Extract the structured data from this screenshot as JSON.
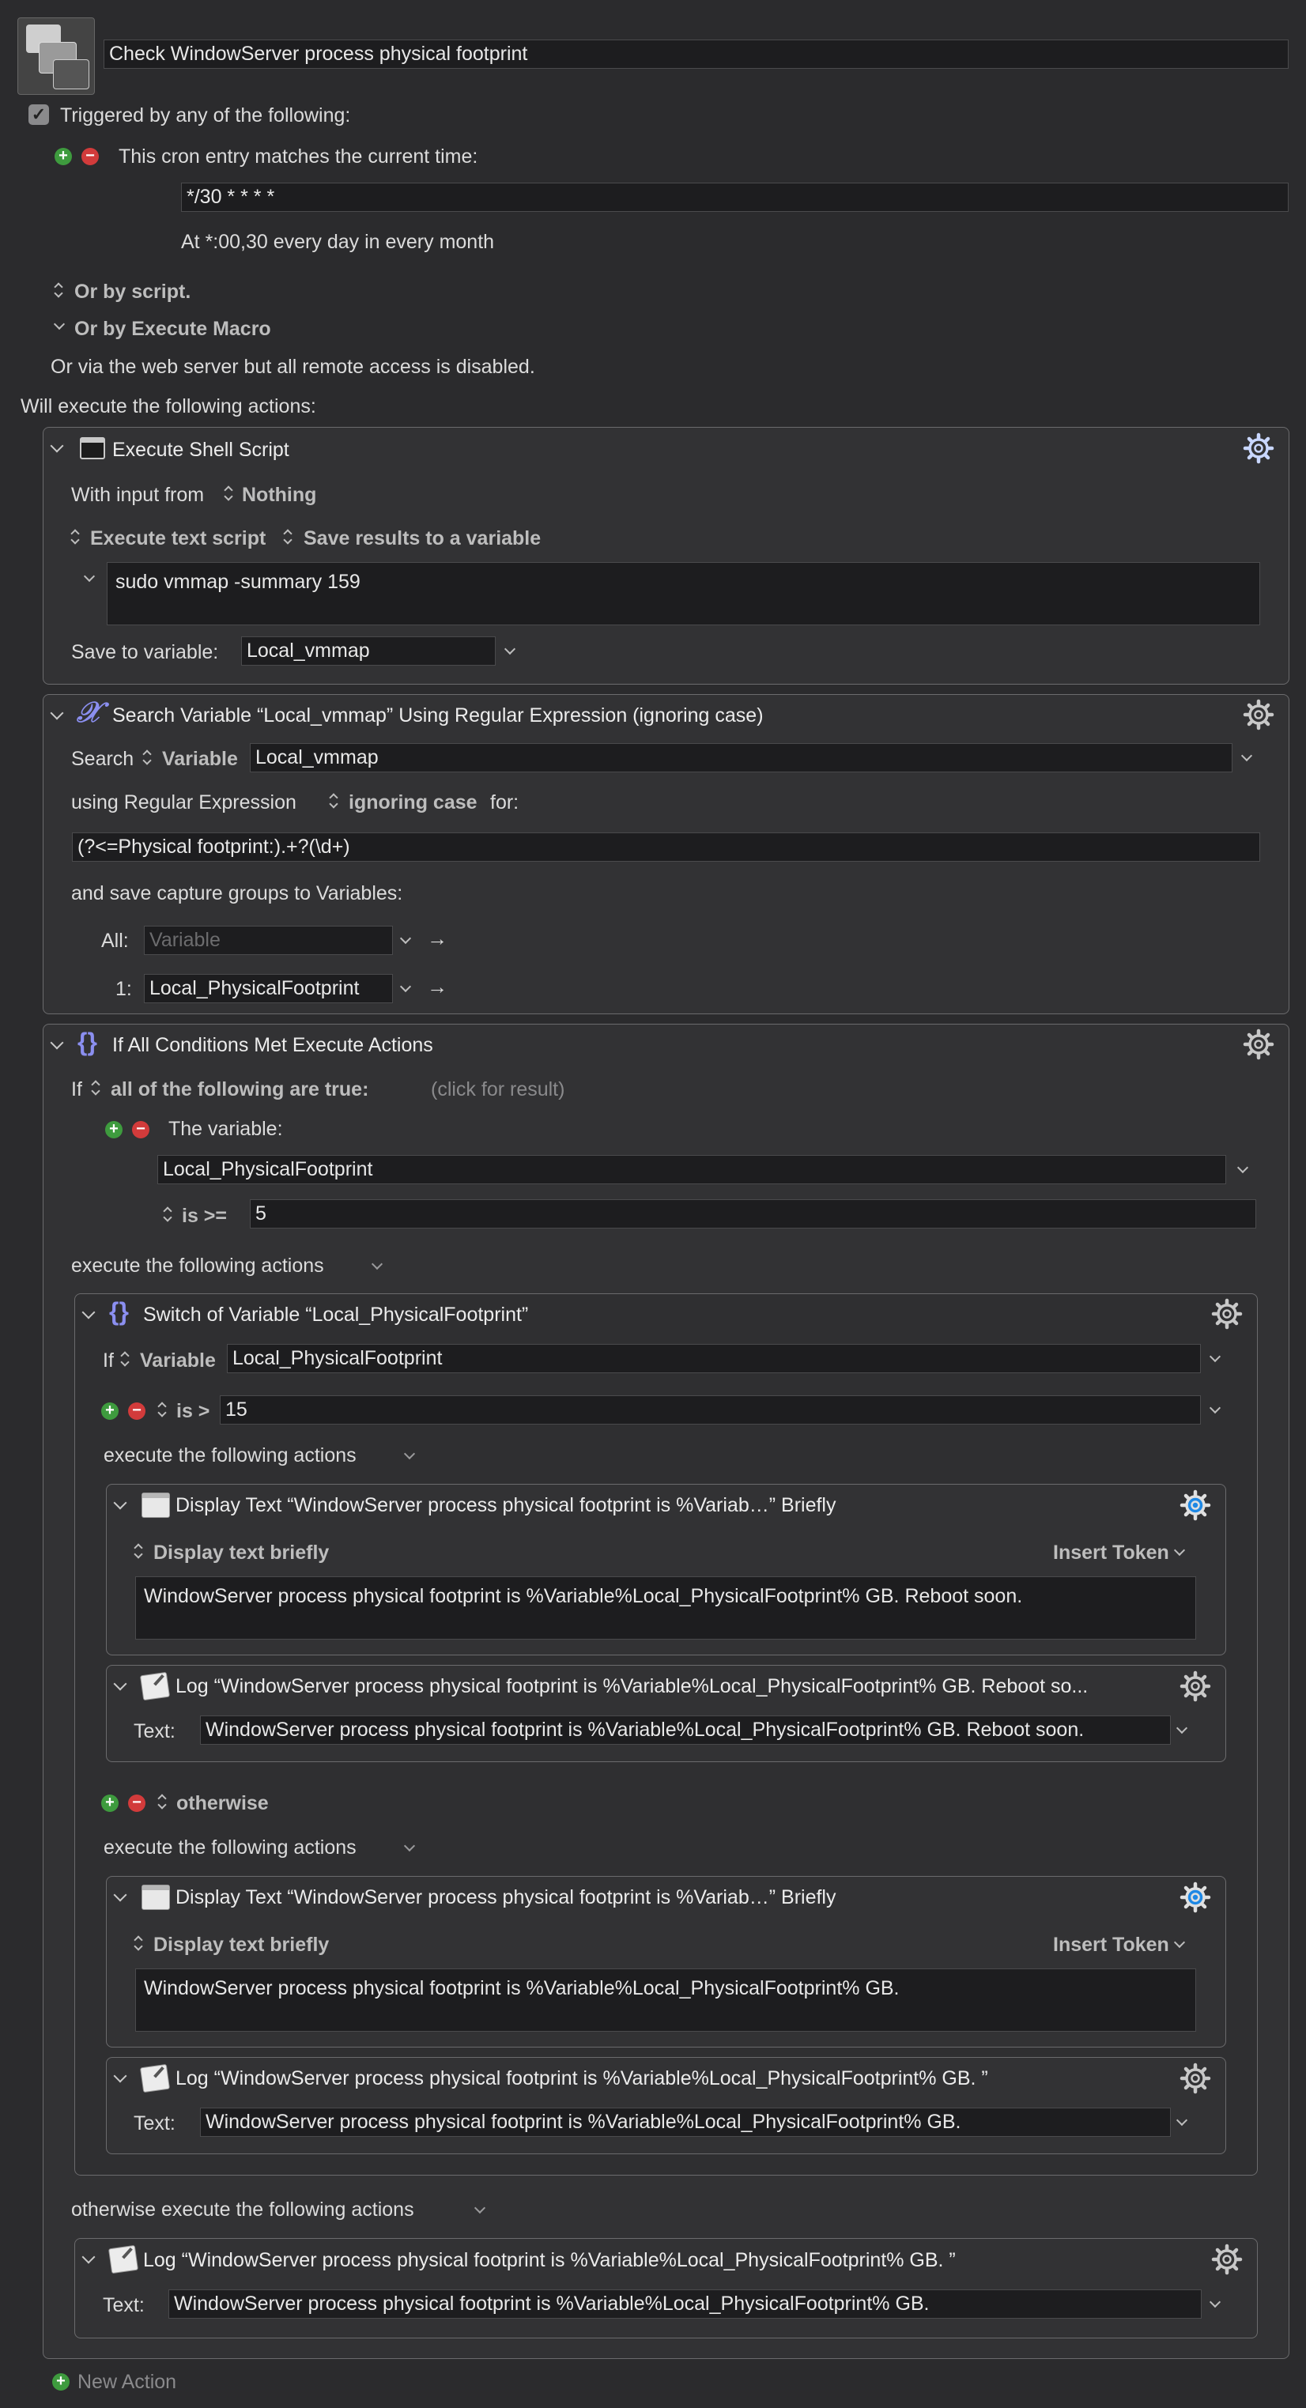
{
  "macro": {
    "name": "Check WindowServer process physical footprint",
    "trigger_header": "Triggered by any of the following:",
    "cron_label": "This cron entry matches the current time:",
    "cron_value": "*/30 * * * *",
    "cron_description": "At *:00,30 every day in every month",
    "or_by_script": "Or by script.",
    "or_by_execute": "Or by Execute Macro",
    "web_server_note": "Or via the web server but all remote access is disabled.",
    "will_execute": "Will execute the following actions:",
    "new_action": "New Action"
  },
  "shell": {
    "title": "Execute Shell Script",
    "input_label": "With input from",
    "input_value": "Nothing",
    "mode_label": "Execute text script",
    "save_mode_label": "Save results to a variable",
    "script": "sudo vmmap -summary 159",
    "save_label": "Save to variable:",
    "save_var": "Local_vmmap"
  },
  "regex": {
    "title": "Search Variable “Local_vmmap” Using Regular Expression (ignoring case)",
    "search_label": "Search",
    "search_type": "Variable",
    "search_var": "Local_vmmap",
    "using_label": "using Regular Expression",
    "case_label": "ignoring case",
    "for_label": "for:",
    "pattern": "(?<=Physical footprint:).+?(\\d+)",
    "save_groups_label": "and save capture groups to Variables:",
    "all_label": "All:",
    "all_placeholder": "Variable",
    "g1_label": "1:",
    "g1_var": "Local_PhysicalFootprint"
  },
  "ifblock": {
    "title": "If All Conditions Met Execute Actions",
    "if_label": "If",
    "cond_mode": "all of the following are true:",
    "click_result": "(click for result)",
    "variable_label": "The variable:",
    "variable": "Local_PhysicalFootprint",
    "operator": "is >=",
    "compare_value": "5",
    "execute_label": "execute the following actions",
    "otherwise_label": "otherwise execute the following actions"
  },
  "switch": {
    "title": "Switch of Variable “Local_PhysicalFootprint”",
    "if_label": "If",
    "type": "Variable",
    "variable": "Local_PhysicalFootprint",
    "case1_operator": "is >",
    "case1_value": "15",
    "execute_label": "execute the following actions",
    "otherwise_case": "otherwise"
  },
  "display1": {
    "title": "Display Text “WindowServer process physical footprint is %Variab…” Briefly",
    "mode": "Display text briefly",
    "insert_token": "Insert Token",
    "text": "WindowServer process physical footprint is %Variable%Local_PhysicalFootprint% GB. Reboot soon."
  },
  "log1": {
    "title": "Log “WindowServer process physical footprint is %Variable%Local_PhysicalFootprint% GB. Reboot so...",
    "text_label": "Text:",
    "text": "WindowServer process physical footprint is %Variable%Local_PhysicalFootprint% GB. Reboot soon."
  },
  "display2": {
    "title": "Display Text “WindowServer process physical footprint is %Variab…” Briefly",
    "mode": "Display text briefly",
    "insert_token": "Insert Token",
    "text": "WindowServer process physical footprint is %Variable%Local_PhysicalFootprint% GB."
  },
  "log2": {
    "title": "Log “WindowServer process physical footprint is %Variable%Local_PhysicalFootprint% GB. ”",
    "text_label": "Text:",
    "text": "WindowServer process physical footprint is %Variable%Local_PhysicalFootprint% GB."
  },
  "log3": {
    "title": "Log “WindowServer process physical footprint is %Variable%Local_PhysicalFootprint% GB. ”",
    "text_label": "Text:",
    "text": "WindowServer process physical footprint is %Variable%Local_PhysicalFootprint% GB."
  },
  "icons": {
    "gear": "gear-icon",
    "gear_active": "blue-gear-icon",
    "clock_gear": "clock-gear-icon",
    "add": "plus-icon",
    "remove": "minus-icon"
  },
  "colors": {
    "background": "#2b2b2d",
    "panel": "#323234",
    "field": "#1d1d1f",
    "accent_blue": "#1e88e5",
    "add_green": "#3e9b3e",
    "remove_red": "#d23b3b",
    "variable_icon": "#8b8ff0"
  }
}
